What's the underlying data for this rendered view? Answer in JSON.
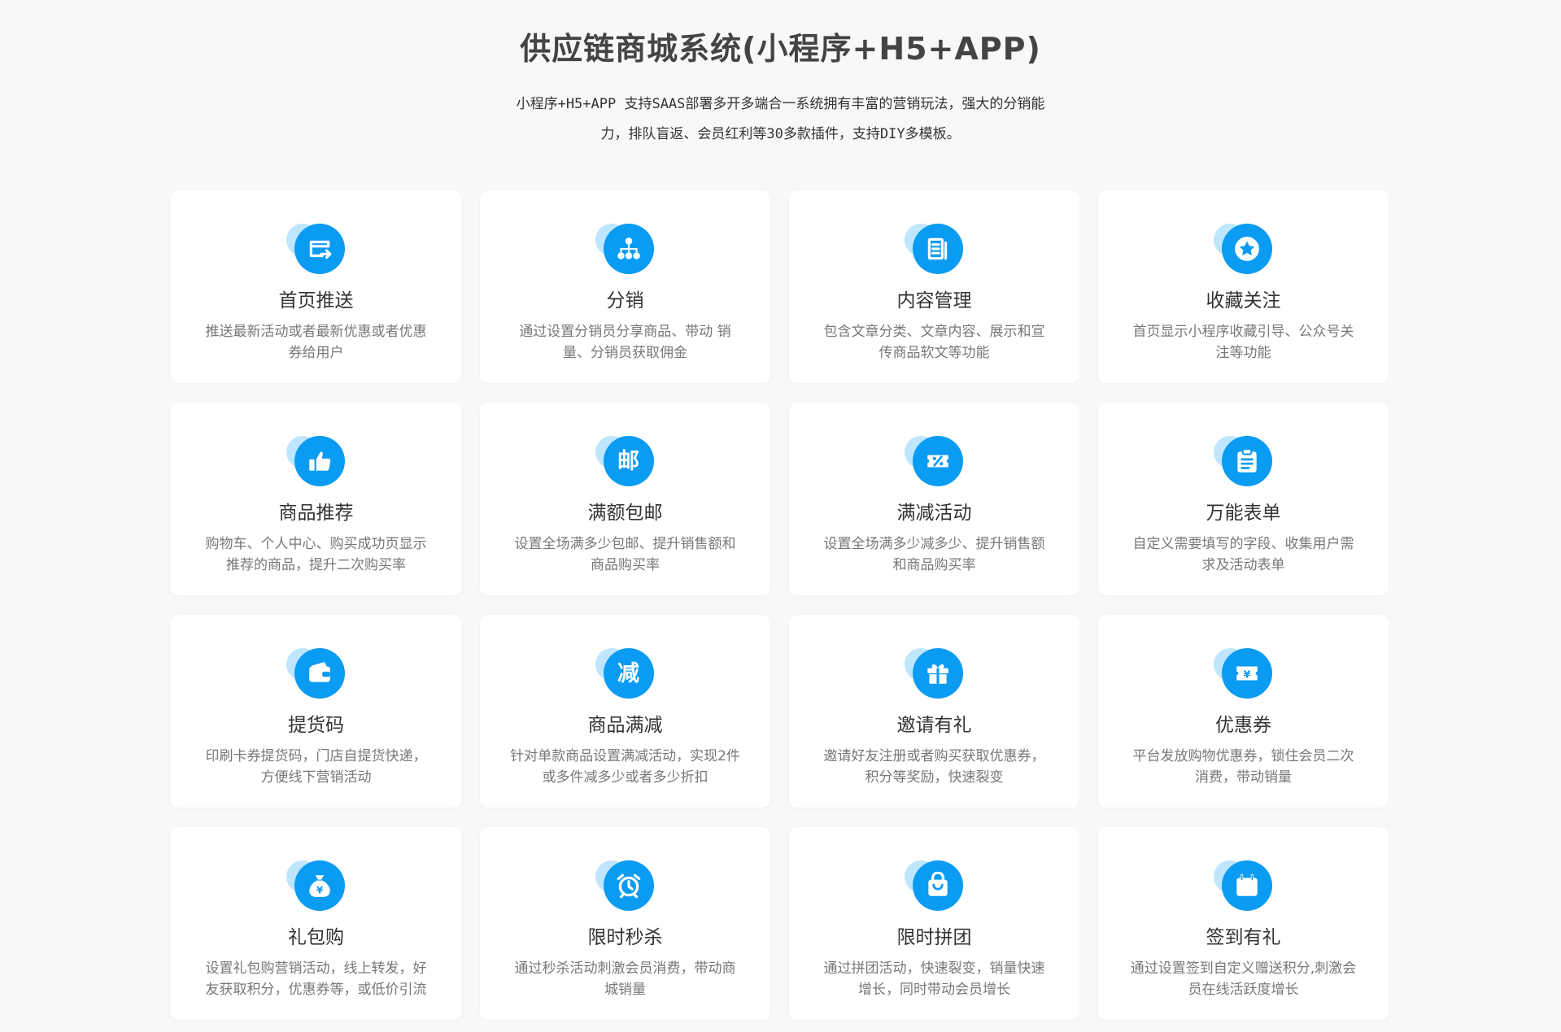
{
  "header": {
    "title": "供应链商城系统(小程序+H5+APP)",
    "subtitle_line1": "小程序+H5+APP 支持SAAS部署多开多端合一系统拥有丰富的营销玩法，强大的分销能",
    "subtitle_line2": "力，排队盲返、会员红利等30多款插件，支持DIY多模板。"
  },
  "theme": {
    "accent": "#0a9bf2",
    "accent_light": "#bfe6ff"
  },
  "features": [
    {
      "icon": "homepage-push-icon",
      "title": "首页推送",
      "desc": "推送最新活动或者最新优惠或者优惠券给用户"
    },
    {
      "icon": "distribution-icon",
      "title": "分销",
      "desc": "通过设置分销员分享商品、带动 销量、分销员获取佣金"
    },
    {
      "icon": "content-management-icon",
      "title": "内容管理",
      "desc": "包含文章分类、文章内容、展示和宣传商品软文等功能"
    },
    {
      "icon": "star-icon",
      "title": "收藏关注",
      "desc": "首页显示小程序收藏引导、公众号关注等功能"
    },
    {
      "icon": "thumbs-up-icon",
      "title": "商品推荐",
      "desc": "购物车、个人中心、购买成功页显示推荐的商品，提升二次购买率"
    },
    {
      "icon": "mail-icon",
      "icon_text": "邮",
      "title": "满额包邮",
      "desc": "设置全场满多少包邮、提升销售额和商品购买率"
    },
    {
      "icon": "discount-ticket-icon",
      "title": "满减活动",
      "desc": "设置全场满多少减多少、提升销售额和商品购买率"
    },
    {
      "icon": "form-icon",
      "title": "万能表单",
      "desc": "自定义需要填写的字段、收集用户需求及活动表单"
    },
    {
      "icon": "wallet-icon",
      "title": "提货码",
      "desc": "印刷卡券提货码，门店自提货快递，方便线下营销活动"
    },
    {
      "icon": "reduce-icon",
      "icon_text": "减",
      "title": "商品满减",
      "desc": "针对单款商品设置满减活动，实现2件或多件减多少或者多少折扣"
    },
    {
      "icon": "gift-icon",
      "title": "邀请有礼",
      "desc": "邀请好友注册或者购买获取优惠券，积分等奖励，快速裂变"
    },
    {
      "icon": "coupon-icon",
      "title": "优惠券",
      "desc": "平台发放购物优惠券，锁住会员二次消费，带动销量"
    },
    {
      "icon": "money-bag-icon",
      "title": "礼包购",
      "desc": "设置礼包购营销活动，线上转发，好友获取积分，优惠券等，或低价引流"
    },
    {
      "icon": "alarm-clock-icon",
      "title": "限时秒杀",
      "desc": "通过秒杀活动刺激会员消费，带动商城销量"
    },
    {
      "icon": "shopping-bag-icon",
      "title": "限时拼团",
      "desc": "通过拼团活动，快速裂变，销量快速增长，同时带动会员增长"
    },
    {
      "icon": "calendar-icon",
      "title": "签到有礼",
      "desc": "通过设置签到自定义赠送积分,刺激会员在线活跃度增长"
    }
  ]
}
